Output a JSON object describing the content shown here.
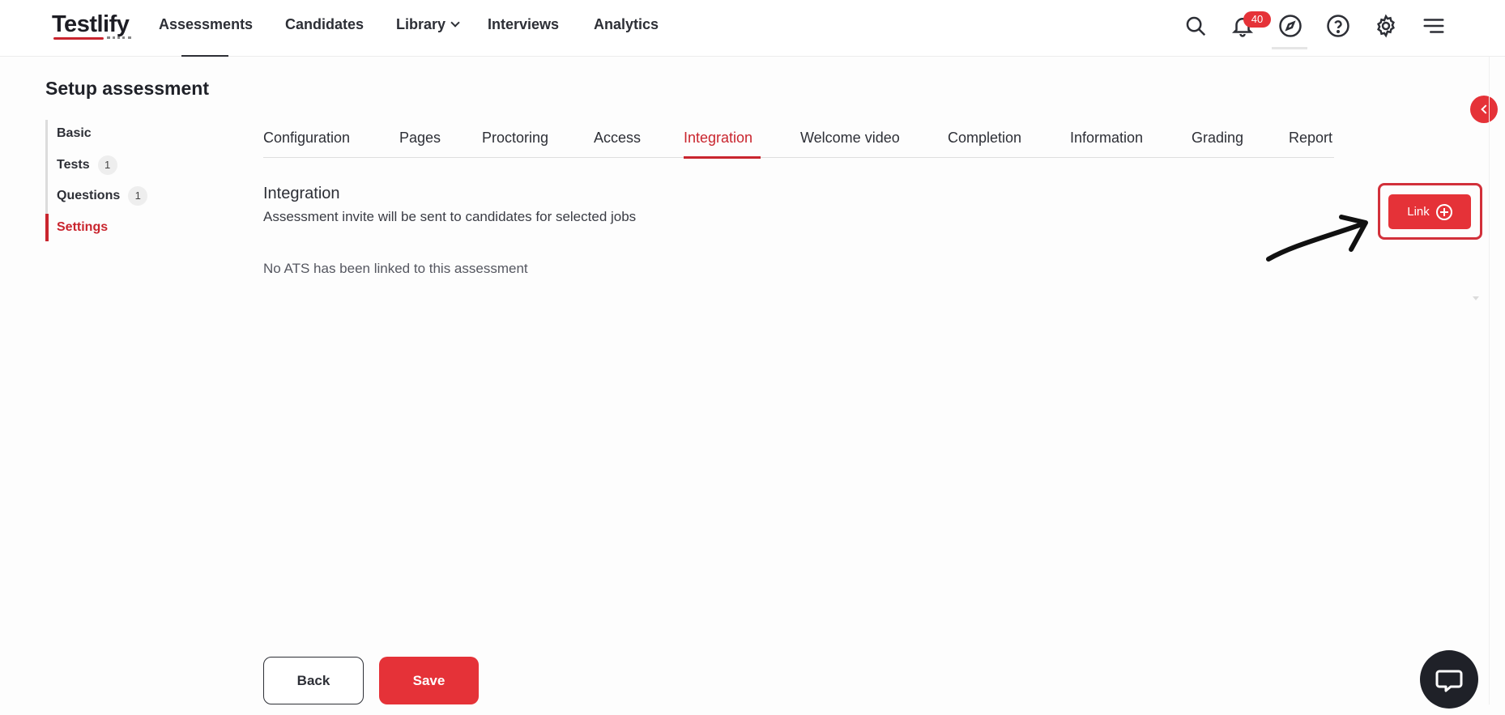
{
  "brand": {
    "name": "Testlify"
  },
  "nav": {
    "items": [
      {
        "label": "Assessments"
      },
      {
        "label": "Candidates"
      },
      {
        "label": "Library"
      },
      {
        "label": "Interviews"
      },
      {
        "label": "Analytics"
      }
    ],
    "notifications_count": "40"
  },
  "page": {
    "title": "Setup assessment"
  },
  "sidebar": {
    "items": [
      {
        "label": "Basic",
        "count": ""
      },
      {
        "label": "Tests",
        "count": "1"
      },
      {
        "label": "Questions",
        "count": "1"
      },
      {
        "label": "Settings",
        "count": ""
      }
    ],
    "active": "Settings"
  },
  "tabs": {
    "items": [
      {
        "label": "Configuration"
      },
      {
        "label": "Pages"
      },
      {
        "label": "Proctoring"
      },
      {
        "label": "Access"
      },
      {
        "label": "Integration"
      },
      {
        "label": "Welcome video"
      },
      {
        "label": "Completion"
      },
      {
        "label": "Information"
      },
      {
        "label": "Grading"
      },
      {
        "label": "Report"
      }
    ],
    "active": "Integration"
  },
  "integration": {
    "title": "Integration",
    "subtitle": "Assessment invite will be sent to candidates for selected jobs",
    "empty_message": "No ATS has been linked to this assessment",
    "link_label": "Link"
  },
  "footer": {
    "back_label": "Back",
    "save_label": "Save"
  },
  "colors": {
    "accent": "#e53238",
    "text": "#2d2f36",
    "active_tab": "#c9252e"
  },
  "icons": [
    "search-icon",
    "bell-icon",
    "compass-icon",
    "help-icon",
    "gear-icon",
    "menu-icon",
    "chevron-left-icon",
    "plus-circle-icon",
    "chat-icon"
  ]
}
